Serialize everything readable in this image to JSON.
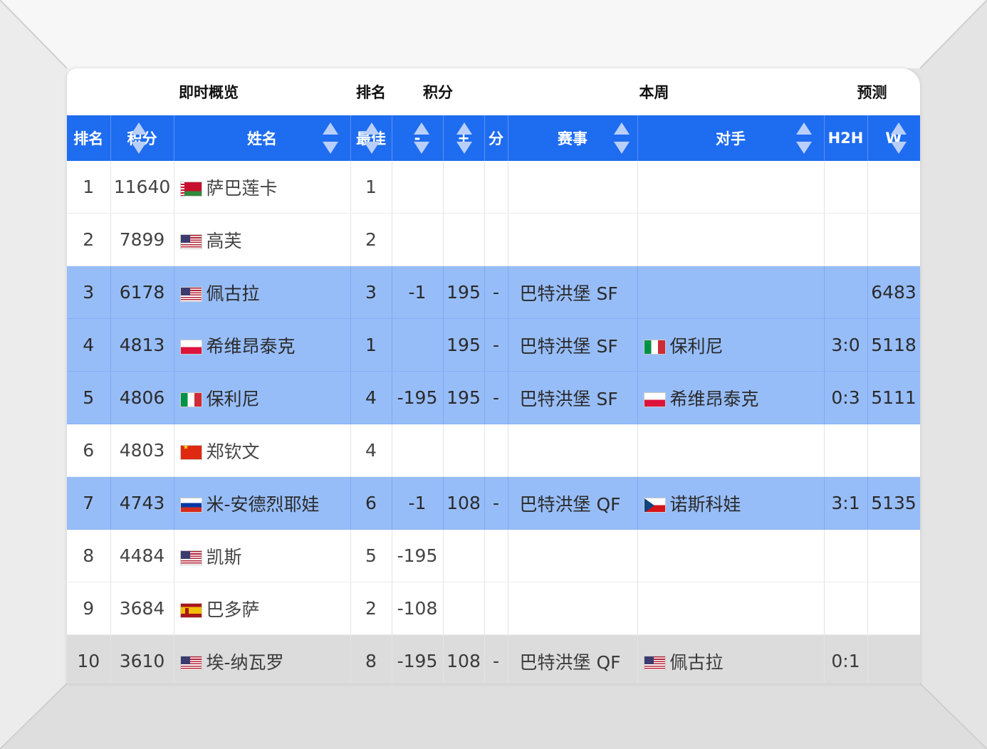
{
  "group_headers": [
    "即时概览",
    "排名",
    "积分",
    "本周",
    "预测"
  ],
  "columns": [
    "排名",
    "积分",
    "姓名",
    "最佳",
    "-",
    "+",
    "分",
    "赛事",
    "对手",
    "H2H",
    "W"
  ],
  "rows": [
    {
      "rank": "1",
      "points": "11640",
      "flag": "by",
      "name": "萨巴莲卡",
      "best": "1",
      "minus": "",
      "plus": "",
      "fen": "",
      "event": "",
      "opp_flag": "",
      "opponent": "",
      "h2h": "",
      "w": "",
      "style": "normal"
    },
    {
      "rank": "2",
      "points": "7899",
      "flag": "us",
      "name": "高芙",
      "best": "2",
      "minus": "",
      "plus": "",
      "fen": "",
      "event": "",
      "opp_flag": "",
      "opponent": "",
      "h2h": "",
      "w": "",
      "style": "normal"
    },
    {
      "rank": "3",
      "points": "6178",
      "flag": "us",
      "name": "佩古拉",
      "best": "3",
      "minus": "-1",
      "plus": "195",
      "fen": "-",
      "event": "巴特洪堡 SF",
      "opp_flag": "",
      "opponent": "",
      "h2h": "",
      "w": "6483",
      "style": "hl"
    },
    {
      "rank": "4",
      "points": "4813",
      "flag": "pl",
      "name": "希维昂泰克",
      "best": "1",
      "minus": "",
      "plus": "195",
      "fen": "-",
      "event": "巴特洪堡 SF",
      "opp_flag": "it",
      "opponent": "保利尼",
      "h2h": "3:0",
      "w": "5118",
      "style": "hl"
    },
    {
      "rank": "5",
      "points": "4806",
      "flag": "it",
      "name": "保利尼",
      "best": "4",
      "minus": "-195",
      "plus": "195",
      "fen": "-",
      "event": "巴特洪堡 SF",
      "opp_flag": "pl",
      "opponent": "希维昂泰克",
      "h2h": "0:3",
      "w": "5111",
      "style": "hl"
    },
    {
      "rank": "6",
      "points": "4803",
      "flag": "cn",
      "name": "郑钦文",
      "best": "4",
      "minus": "",
      "plus": "",
      "fen": "",
      "event": "",
      "opp_flag": "",
      "opponent": "",
      "h2h": "",
      "w": "",
      "style": "normal"
    },
    {
      "rank": "7",
      "points": "4743",
      "flag": "ru",
      "name": "米-安德烈耶娃",
      "best": "6",
      "minus": "-1",
      "plus": "108",
      "fen": "-",
      "event": "巴特洪堡 QF",
      "opp_flag": "cz",
      "opponent": "诺斯科娃",
      "h2h": "3:1",
      "w": "5135",
      "style": "hl"
    },
    {
      "rank": "8",
      "points": "4484",
      "flag": "us",
      "name": "凯斯",
      "best": "5",
      "minus": "-195",
      "plus": "",
      "fen": "",
      "event": "",
      "opp_flag": "",
      "opponent": "",
      "h2h": "",
      "w": "",
      "style": "normal"
    },
    {
      "rank": "9",
      "points": "3684",
      "flag": "es",
      "name": "巴多萨",
      "best": "2",
      "minus": "-108",
      "plus": "",
      "fen": "",
      "event": "",
      "opp_flag": "",
      "opponent": "",
      "h2h": "",
      "w": "",
      "style": "normal"
    },
    {
      "rank": "10",
      "points": "3610",
      "flag": "us",
      "name": "埃-纳瓦罗",
      "best": "8",
      "minus": "-195",
      "plus": "108",
      "fen": "-",
      "event": "巴特洪堡 QF",
      "opp_flag": "us",
      "opponent": "佩古拉",
      "h2h": "0:1",
      "w": "",
      "style": "gray"
    }
  ],
  "colors": {
    "header_blue": "#1e6cf0",
    "highlight": "#97bdf9",
    "gray_row": "#dcdcdc"
  }
}
